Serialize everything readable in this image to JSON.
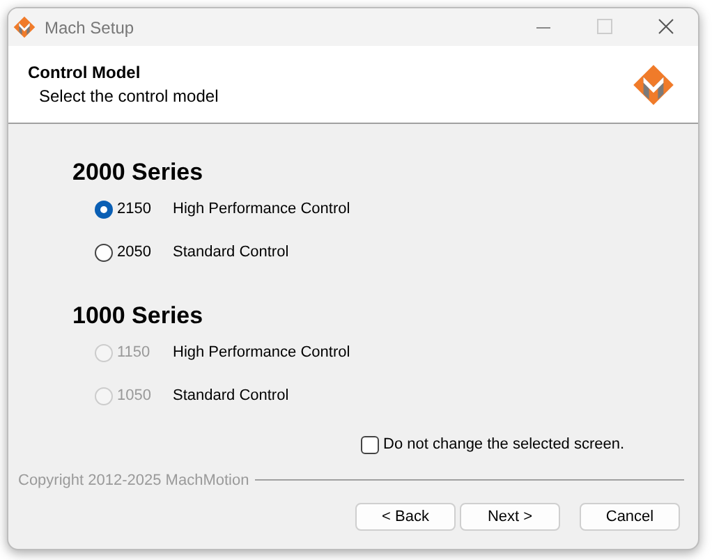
{
  "window": {
    "title": "Mach Setup"
  },
  "header": {
    "title": "Control Model",
    "subtitle": "Select the control model"
  },
  "series": [
    {
      "heading": "2000 Series",
      "options": [
        {
          "number": "2150",
          "description": "High Performance Control",
          "selected": true,
          "disabled": false
        },
        {
          "number": "2050",
          "description": "Standard Control",
          "selected": false,
          "disabled": false
        }
      ]
    },
    {
      "heading": "1000 Series",
      "options": [
        {
          "number": "1150",
          "description": "High Performance Control",
          "selected": false,
          "disabled": true
        },
        {
          "number": "1050",
          "description": "Standard Control",
          "selected": false,
          "disabled": true
        }
      ]
    }
  ],
  "keep_screen": {
    "label": "Do not change the selected screen.",
    "checked": false
  },
  "copyright": "Copyright 2012-2025 MachMotion",
  "buttons": [
    "< Back",
    "Next >",
    "Cancel"
  ]
}
